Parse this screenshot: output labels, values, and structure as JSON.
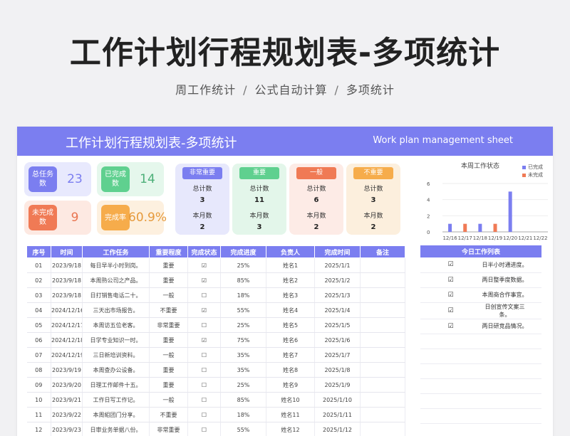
{
  "header": {
    "title": "工作计划行程规划表-多项统计",
    "subtitle_parts": [
      "周工作统计",
      "公式自动计算",
      "多项统计"
    ],
    "separator": "/"
  },
  "sheet": {
    "banner_title": "工作计划行程规划表-多项统计",
    "banner_en": "Work plan management sheet"
  },
  "summary": {
    "total_tasks": {
      "label": "总任务数",
      "value": "23"
    },
    "done": {
      "label": "已完成数",
      "value": "14"
    },
    "undone": {
      "label": "未完成数",
      "value": "9"
    },
    "rate": {
      "label": "完成率",
      "value": "60.9%"
    }
  },
  "priority_cards": [
    {
      "tag": "非常重要",
      "total_label": "总计数",
      "total": "3",
      "month_label": "本月数",
      "month": "2"
    },
    {
      "tag": "重要",
      "total_label": "总计数",
      "total": "11",
      "month_label": "本月数",
      "month": "3"
    },
    {
      "tag": "一般",
      "total_label": "总计数",
      "total": "6",
      "month_label": "本月数",
      "month": "2"
    },
    {
      "tag": "不重要",
      "total_label": "总计数",
      "total": "3",
      "month_label": "本月数",
      "month": "2"
    }
  ],
  "colors": {
    "accent": "#7b7ef0",
    "total_badge": "#7b7ef0",
    "total_bg": "#e8e9fd",
    "done_badge": "#5fd08f",
    "done_bg": "#e5f7ec",
    "done_text": "#4caf78",
    "undone_badge": "#f07a55",
    "undone_bg": "#fde9e2",
    "undone_text": "#e9744f",
    "rate_badge": "#f6ac4b",
    "rate_bg": "#fdf0df",
    "rate_text": "#e69a3c",
    "card_bgs": [
      "#e7e8fc",
      "#e3f6ea",
      "#fdebe6",
      "#fcefdd"
    ],
    "card_tags": [
      "#7b7ef0",
      "#5fd08f",
      "#f07a55",
      "#f6ac4b"
    ],
    "series_done": "#7b7ef0",
    "series_undone": "#f07a55"
  },
  "chart_data": {
    "type": "bar",
    "title": "本周工作状态",
    "categories": [
      "12/16",
      "12/17",
      "12/18",
      "12/19",
      "12/20",
      "12/21",
      "12/22"
    ],
    "series": [
      {
        "name": "已完成",
        "values": [
          1,
          0,
          1,
          0,
          5,
          0,
          0
        ]
      },
      {
        "name": "未完成",
        "values": [
          0,
          1,
          0,
          1,
          0,
          0,
          0
        ]
      }
    ],
    "yticks": [
      0,
      2,
      4,
      6
    ],
    "ylim": [
      0,
      6
    ],
    "legend": "top-right"
  },
  "table": {
    "columns": [
      "序号",
      "时间",
      "工作任务",
      "重要程度",
      "完成状态",
      "完成进度",
      "负责人",
      "完成时间",
      "备注"
    ],
    "rows": [
      [
        "01",
        "2023/9/18",
        "每日早半小时到岗。",
        "重要",
        "☑",
        "25%",
        "姓名1",
        "2025/1/1",
        ""
      ],
      [
        "02",
        "2023/9/18",
        "本周熟公司之产品。",
        "重要",
        "☑",
        "85%",
        "姓名2",
        "2025/1/2",
        ""
      ],
      [
        "03",
        "2023/9/18",
        "日打销售电话二十。",
        "一般",
        "☐",
        "18%",
        "姓名3",
        "2025/1/3",
        ""
      ],
      [
        "04",
        "2024/12/16",
        "三天出市场报告。",
        "不重要",
        "☑",
        "55%",
        "姓名4",
        "2025/1/4",
        ""
      ],
      [
        "05",
        "2024/12/17",
        "本周访五位老客。",
        "非常重要",
        "☐",
        "25%",
        "姓名5",
        "2025/1/5",
        ""
      ],
      [
        "06",
        "2024/12/18",
        "日学专业知识一时。",
        "重要",
        "☑",
        "75%",
        "姓名6",
        "2025/1/6",
        ""
      ],
      [
        "07",
        "2024/12/19",
        "三日新培训资料。",
        "一般",
        "☐",
        "35%",
        "姓名7",
        "2025/1/7",
        ""
      ],
      [
        "08",
        "2023/9/19",
        "本周查办公设备。",
        "重要",
        "☐",
        "35%",
        "姓名8",
        "2025/1/8",
        ""
      ],
      [
        "09",
        "2023/9/20",
        "日理工作邮件十五。",
        "重要",
        "☐",
        "25%",
        "姓名9",
        "2025/1/9",
        ""
      ],
      [
        "10",
        "2023/9/21",
        "工作日写工作记。",
        "一般",
        "☐",
        "85%",
        "姓名10",
        "2025/1/10",
        ""
      ],
      [
        "11",
        "2023/9/22",
        "本周組团门分享。",
        "不重要",
        "☐",
        "18%",
        "姓名11",
        "2025/1/11",
        ""
      ],
      [
        "12",
        "2023/9/23",
        "日审业务单据八份。",
        "非常重要",
        "☐",
        "55%",
        "姓名12",
        "2025/1/12",
        ""
      ]
    ]
  },
  "todo": {
    "title": "今日工作列表",
    "items": [
      {
        "check": "☑",
        "text": "日半小时通进度。"
      },
      {
        "check": "☑",
        "text": "两日整季度数据。"
      },
      {
        "check": "☑",
        "text": "本周商合作事宜。"
      },
      {
        "check": "☑",
        "text": "日创宣传文案三条。"
      },
      {
        "check": "☑",
        "text": "两日研竞品情况。"
      },
      {
        "check": "",
        "text": ""
      },
      {
        "check": "",
        "text": ""
      },
      {
        "check": "",
        "text": ""
      },
      {
        "check": "",
        "text": ""
      },
      {
        "check": "",
        "text": ""
      },
      {
        "check": "",
        "text": ""
      },
      {
        "check": "",
        "text": ""
      }
    ]
  }
}
